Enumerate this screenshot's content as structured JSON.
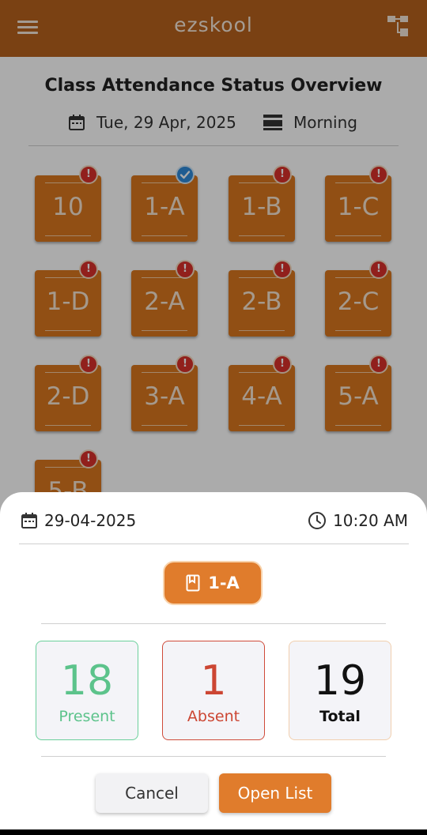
{
  "app": {
    "title": "ezskool"
  },
  "header": {
    "title": "Class Attendance Status Overview",
    "date": "Tue, 29 Apr, 2025",
    "session": "Morning"
  },
  "classes": [
    {
      "label": "10",
      "status": "pending"
    },
    {
      "label": "1-A",
      "status": "done"
    },
    {
      "label": "1-B",
      "status": "pending"
    },
    {
      "label": "1-C",
      "status": "pending"
    },
    {
      "label": "1-D",
      "status": "pending"
    },
    {
      "label": "2-A",
      "status": "pending"
    },
    {
      "label": "2-B",
      "status": "pending"
    },
    {
      "label": "2-C",
      "status": "pending"
    },
    {
      "label": "2-D",
      "status": "pending"
    },
    {
      "label": "3-A",
      "status": "pending"
    },
    {
      "label": "4-A",
      "status": "pending"
    },
    {
      "label": "5-A",
      "status": "pending"
    },
    {
      "label": "5-B",
      "status": "pending"
    }
  ],
  "sheet": {
    "date": "29-04-2025",
    "time": "10:20 AM",
    "class_chip": "1-A",
    "present": {
      "value": "18",
      "label": "Present"
    },
    "absent": {
      "value": "1",
      "label": "Absent"
    },
    "total": {
      "value": "19",
      "label": "Total"
    },
    "cancel_label": "Cancel",
    "open_label": "Open List"
  },
  "colors": {
    "brand": "#b6611d",
    "tile": "#d8771f",
    "accent": "#e07c2c",
    "present": "#5cc38b",
    "absent": "#cc4633",
    "pending_badge": "#d9302a",
    "done_badge": "#2f8ad8"
  }
}
